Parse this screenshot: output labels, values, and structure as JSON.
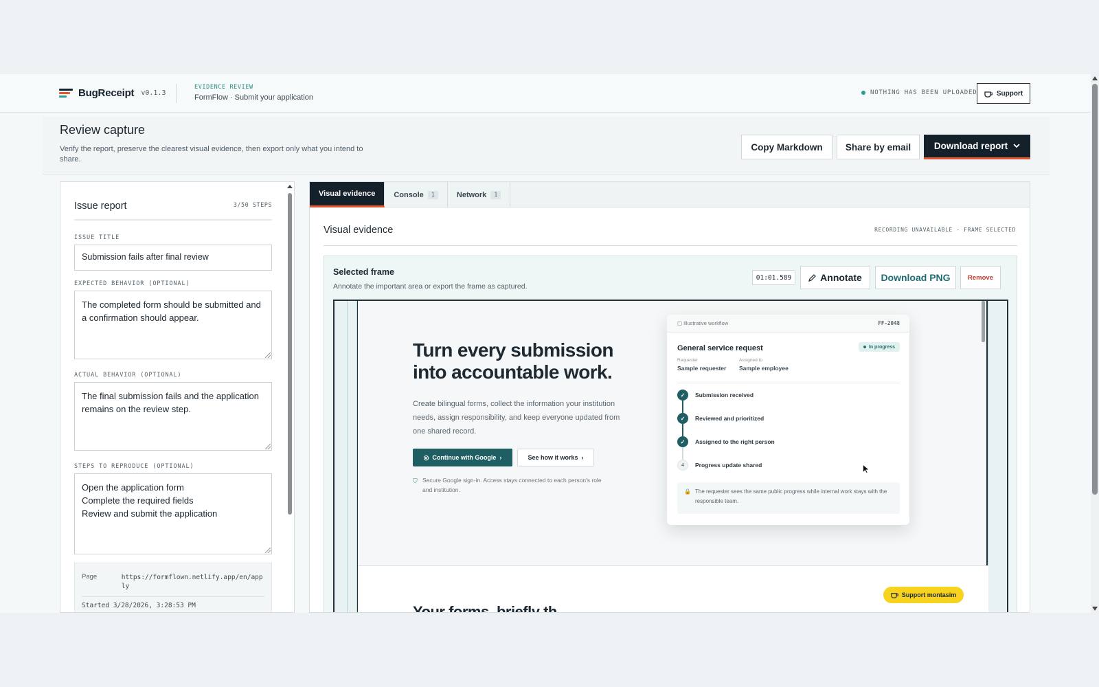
{
  "header": {
    "brand_name": "BugReceipt",
    "version": "v0.1.3",
    "kicker": "EVIDENCE REVIEW",
    "page_title": "FormFlow · Submit your application",
    "upload_status": "NOTHING HAS BEEN UPLOADED",
    "support_label": "Support",
    "brand_colors": [
      "#e4572e",
      "#14202a",
      "#2a9b8f"
    ]
  },
  "review": {
    "title": "Review capture",
    "subtitle": "Verify the report, preserve the clearest visual evidence, then export only what you intend to share.",
    "copy_markdown": "Copy Markdown",
    "share_email": "Share by email",
    "download_report": "Download report"
  },
  "issue": {
    "panel_title": "Issue report",
    "steps_count": "3/50 STEPS",
    "title_label": "ISSUE TITLE",
    "title_value": "Submission fails after final review",
    "expected_label": "EXPECTED BEHAVIOR (OPTIONAL)",
    "expected_value": "The completed form should be submitted and a confirmation should appear.",
    "actual_label": "ACTUAL BEHAVIOR (OPTIONAL)",
    "actual_value": "The final submission fails and the application remains on the review step.",
    "steps_label": "STEPS TO REPRODUCE (OPTIONAL)",
    "steps": [
      "Open the application form",
      "Complete the required fields",
      "Review and submit the application"
    ],
    "meta": {
      "page_key": "Page",
      "page_value": "https://formflown.netlify.app/en/apply",
      "started_partial": "Started  3/28/2026, 3:28:53 PM"
    }
  },
  "tabs": [
    {
      "label": "Visual evidence",
      "count": ""
    },
    {
      "label": "Console",
      "count": "1"
    },
    {
      "label": "Network",
      "count": "1"
    }
  ],
  "evidence": {
    "title": "Visual evidence",
    "status": "RECORDING UNAVAILABLE · FRAME SELECTED",
    "frame_title": "Selected frame",
    "frame_sub": "Annotate the important area or export the frame as captured.",
    "timecode": "01:01.589",
    "annotate": "Annotate",
    "download_png": "Download PNG",
    "remove": "Remove"
  },
  "capture": {
    "hero_title_1": "Turn every submission",
    "hero_title_2": "into accountable work.",
    "hero_sub": "Create bilingual forms, collect the information your institution needs, assign responsibility, and keep everyone updated from one shared record.",
    "google_btn": "Continue with Google",
    "how_btn": "See how it works",
    "note": "Secure Google sign-in. Access stays connected to each person's role and institution.",
    "card_label": "Illustrative workflow",
    "card_id": "FF-2048",
    "card_title": "General service request",
    "card_badge": "In progress",
    "requester_key": "Requester",
    "requester_val": "Sample requester",
    "assigned_key": "Assigned to",
    "assigned_val": "Sample employee",
    "steps": [
      "Submission received",
      "Reviewed and prioritized",
      "Assigned to the right person",
      "Progress update shared"
    ],
    "pending_step_number": "4",
    "info": "The requester sees the same public progress while internal work stays with the responsible team.",
    "lower_heading": "Your forms, briefly th...",
    "support_pill": "Support montasim"
  }
}
